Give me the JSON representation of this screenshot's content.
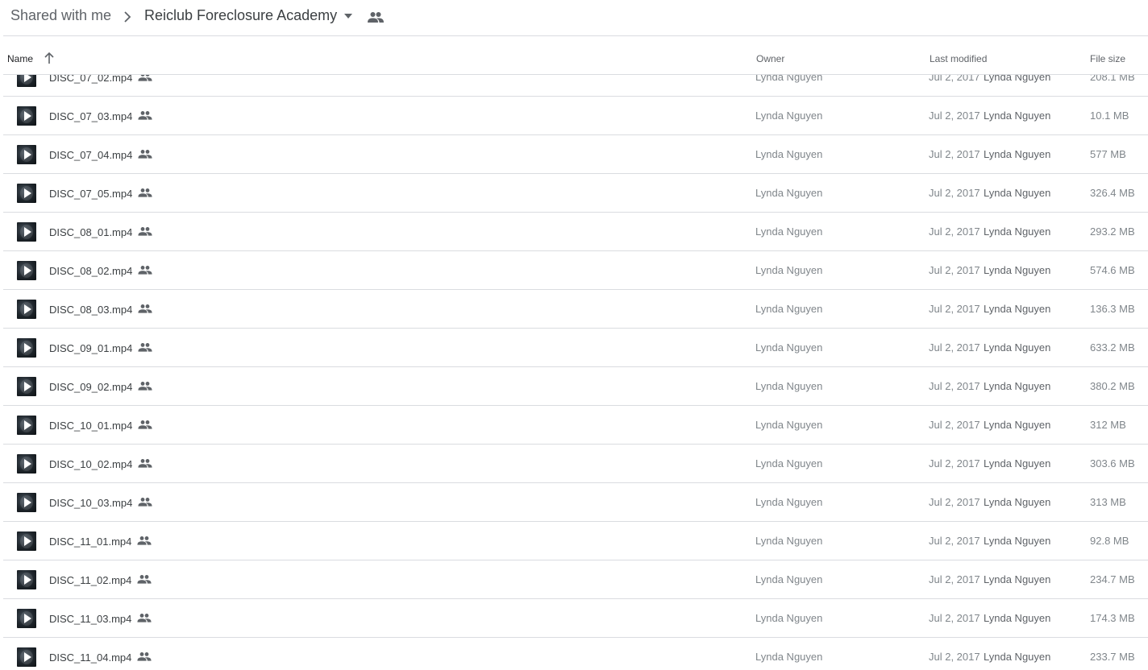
{
  "breadcrumb": {
    "root": "Shared with me",
    "current": "Reiclub Foreclosure Academy"
  },
  "columns": {
    "name": "Name",
    "owner": "Owner",
    "last_modified": "Last modified",
    "file_size": "File size"
  },
  "files": [
    {
      "name": "DISC_07_02.mp4",
      "owner": "Lynda Nguyen",
      "date": "Jul 2, 2017",
      "modified_by": "Lynda Nguyen",
      "size": "208.1 MB"
    },
    {
      "name": "DISC_07_03.mp4",
      "owner": "Lynda Nguyen",
      "date": "Jul 2, 2017",
      "modified_by": "Lynda Nguyen",
      "size": "10.1 MB"
    },
    {
      "name": "DISC_07_04.mp4",
      "owner": "Lynda Nguyen",
      "date": "Jul 2, 2017",
      "modified_by": "Lynda Nguyen",
      "size": "577 MB"
    },
    {
      "name": "DISC_07_05.mp4",
      "owner": "Lynda Nguyen",
      "date": "Jul 2, 2017",
      "modified_by": "Lynda Nguyen",
      "size": "326.4 MB"
    },
    {
      "name": "DISC_08_01.mp4",
      "owner": "Lynda Nguyen",
      "date": "Jul 2, 2017",
      "modified_by": "Lynda Nguyen",
      "size": "293.2 MB"
    },
    {
      "name": "DISC_08_02.mp4",
      "owner": "Lynda Nguyen",
      "date": "Jul 2, 2017",
      "modified_by": "Lynda Nguyen",
      "size": "574.6 MB"
    },
    {
      "name": "DISC_08_03.mp4",
      "owner": "Lynda Nguyen",
      "date": "Jul 2, 2017",
      "modified_by": "Lynda Nguyen",
      "size": "136.3 MB"
    },
    {
      "name": "DISC_09_01.mp4",
      "owner": "Lynda Nguyen",
      "date": "Jul 2, 2017",
      "modified_by": "Lynda Nguyen",
      "size": "633.2 MB"
    },
    {
      "name": "DISC_09_02.mp4",
      "owner": "Lynda Nguyen",
      "date": "Jul 2, 2017",
      "modified_by": "Lynda Nguyen",
      "size": "380.2 MB"
    },
    {
      "name": "DISC_10_01.mp4",
      "owner": "Lynda Nguyen",
      "date": "Jul 2, 2017",
      "modified_by": "Lynda Nguyen",
      "size": "312 MB"
    },
    {
      "name": "DISC_10_02.mp4",
      "owner": "Lynda Nguyen",
      "date": "Jul 2, 2017",
      "modified_by": "Lynda Nguyen",
      "size": "303.6 MB"
    },
    {
      "name": "DISC_10_03.mp4",
      "owner": "Lynda Nguyen",
      "date": "Jul 2, 2017",
      "modified_by": "Lynda Nguyen",
      "size": "313 MB"
    },
    {
      "name": "DISC_11_01.mp4",
      "owner": "Lynda Nguyen",
      "date": "Jul 2, 2017",
      "modified_by": "Lynda Nguyen",
      "size": "92.8 MB"
    },
    {
      "name": "DISC_11_02.mp4",
      "owner": "Lynda Nguyen",
      "date": "Jul 2, 2017",
      "modified_by": "Lynda Nguyen",
      "size": "234.7 MB"
    },
    {
      "name": "DISC_11_03.mp4",
      "owner": "Lynda Nguyen",
      "date": "Jul 2, 2017",
      "modified_by": "Lynda Nguyen",
      "size": "174.3 MB"
    },
    {
      "name": "DISC_11_04.mp4",
      "owner": "Lynda Nguyen",
      "date": "Jul 2, 2017",
      "modified_by": "Lynda Nguyen",
      "size": "233.7 MB"
    }
  ],
  "icons": {
    "breadcrumb_separator": "chevron-right-icon",
    "folder_menu": "caret-down-icon",
    "shared": "people-icon",
    "sort": "arrow-up-icon",
    "file_thumbnail": "video-play-icon"
  },
  "colors": {
    "divider": "#dadce0",
    "muted_text": "#80868b",
    "primary_text": "#3c4043"
  }
}
